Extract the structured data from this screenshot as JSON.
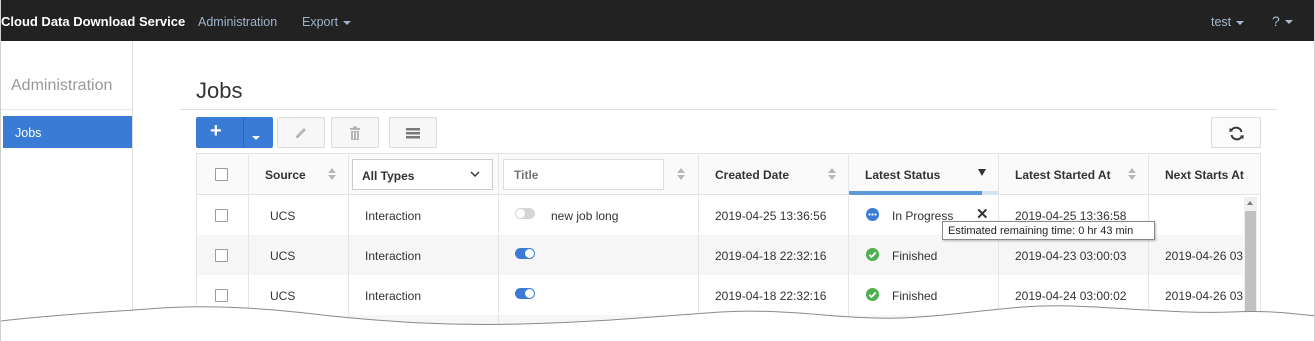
{
  "navbar": {
    "brand": "Cloud Data Download Service",
    "links": [
      "Administration",
      "Export"
    ],
    "user": "test",
    "help": "?"
  },
  "sidebar": {
    "title": "Administration",
    "items": [
      {
        "label": "Jobs",
        "active": true
      }
    ]
  },
  "page": {
    "title": "Jobs"
  },
  "toolbar": {
    "add_icon": "plus-icon",
    "edit_icon": "pencil-icon",
    "delete_icon": "trash-icon",
    "columns_icon": "list-icon",
    "refresh_icon": "refresh-icon"
  },
  "table": {
    "headers": {
      "source": "Source",
      "type_select": "All Types",
      "title_placeholder": "Title",
      "created": "Created Date",
      "status": "Latest Status",
      "started": "Latest Started At",
      "next": "Next Starts At"
    },
    "status_progress": 0.89,
    "rows": [
      {
        "source": "UCS",
        "type": "Interaction",
        "enabled": false,
        "title": "new job long",
        "created": "2019-04-25 13:36:56",
        "status": "In Progress",
        "status_kind": "progress",
        "started": "2019-04-25 13:36:58",
        "next": ""
      },
      {
        "source": "UCS",
        "type": "Interaction",
        "enabled": true,
        "title": "",
        "created": "2019-04-18 22:32:16",
        "status": "Finished",
        "status_kind": "ok",
        "started": "2019-04-23 03:00:03",
        "next": "2019-04-26 03"
      },
      {
        "source": "UCS",
        "type": "Interaction",
        "enabled": true,
        "title": "",
        "created": "2019-04-18 22:32:16",
        "status": "Finished",
        "status_kind": "ok",
        "started": "2019-04-24 03:00:02",
        "next": "2019-04-26 03"
      },
      {
        "source": "",
        "type": "",
        "enabled": true,
        "title": "",
        "created": "",
        "status": "",
        "status_kind": "",
        "started": "",
        "next": ""
      }
    ]
  },
  "tooltip": "Estimated remaining time: 0 hr 43 min",
  "colors": {
    "navbar": "#222222",
    "accent": "#3a7bd5",
    "ok": "#4caf50"
  }
}
